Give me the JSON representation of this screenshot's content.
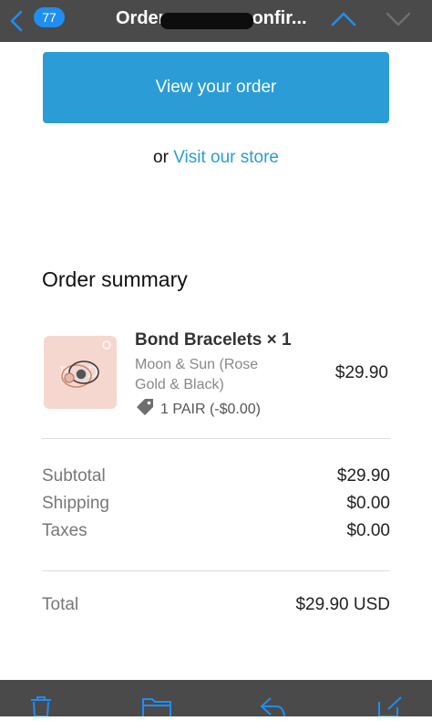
{
  "topbar": {
    "unread_count": "77",
    "title_left": "Order",
    "title_right": "confir...",
    "accent": "#1f8ef1"
  },
  "main": {
    "view_order_label": "View your order",
    "or_text": "or",
    "visit_store_link": "Visit our store",
    "summary_title": "Order summary",
    "button_color": "#2b9cd6"
  },
  "item": {
    "name": "Bond Bracelets × 1",
    "variant": "Moon & Sun (Rose Gold & Black)",
    "discount": "1 PAIR (-$0.00)",
    "price": "$29.90",
    "image_icon": "bracelet-product-image"
  },
  "totals": {
    "subtotal_label": "Subtotal",
    "subtotal_value": "$29.90",
    "shipping_label": "Shipping",
    "shipping_value": "$0.00",
    "taxes_label": "Taxes",
    "taxes_value": "$0.00",
    "total_label": "Total",
    "total_value": "$29.90 USD"
  },
  "toolbar": {
    "icons": [
      "trash-icon",
      "folder-icon",
      "reply-icon",
      "compose-icon"
    ]
  }
}
